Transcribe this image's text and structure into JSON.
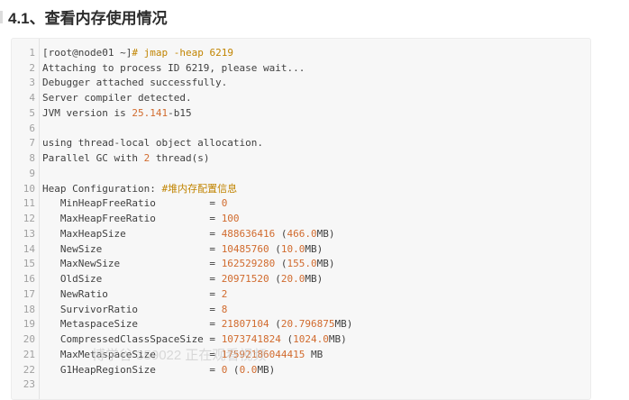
{
  "heading": "4.1、查看内存使用情况",
  "watermark": "博学谷 359022 正在观看视频",
  "lines": [
    {
      "n": "1",
      "segs": [
        {
          "t": "[root@node01 ~]",
          "c": "prompt"
        },
        {
          "t": "# jmap",
          "c": "cmd"
        },
        {
          "t": " -heap 6219",
          "c": "cmd"
        }
      ]
    },
    {
      "n": "2",
      "segs": [
        {
          "t": "Attaching to process ID 6219, please wait...",
          "c": ""
        }
      ]
    },
    {
      "n": "3",
      "segs": [
        {
          "t": "Debugger attached successfully.",
          "c": ""
        }
      ]
    },
    {
      "n": "4",
      "segs": [
        {
          "t": "Server compiler detected.",
          "c": ""
        }
      ]
    },
    {
      "n": "5",
      "segs": [
        {
          "t": "JVM version is ",
          "c": ""
        },
        {
          "t": "25.141",
          "c": "num"
        },
        {
          "t": "-b15",
          "c": ""
        }
      ]
    },
    {
      "n": "6",
      "segs": [
        {
          "t": "",
          "c": ""
        }
      ]
    },
    {
      "n": "7",
      "segs": [
        {
          "t": "using thread-local object allocation.",
          "c": ""
        }
      ]
    },
    {
      "n": "8",
      "segs": [
        {
          "t": "Parallel GC with ",
          "c": ""
        },
        {
          "t": "2",
          "c": "num"
        },
        {
          "t": " thread(s)",
          "c": ""
        }
      ]
    },
    {
      "n": "9",
      "segs": [
        {
          "t": "",
          "c": ""
        }
      ]
    },
    {
      "n": "10",
      "segs": [
        {
          "t": "Heap Configuration: ",
          "c": ""
        },
        {
          "t": "#堆内存配置信息",
          "c": "comment"
        }
      ]
    },
    {
      "n": "11",
      "segs": [
        {
          "t": "   MinHeapFreeRatio         = ",
          "c": ""
        },
        {
          "t": "0",
          "c": "num"
        }
      ]
    },
    {
      "n": "12",
      "segs": [
        {
          "t": "   MaxHeapFreeRatio         = ",
          "c": ""
        },
        {
          "t": "100",
          "c": "num"
        }
      ]
    },
    {
      "n": "13",
      "segs": [
        {
          "t": "   MaxHeapSize              = ",
          "c": ""
        },
        {
          "t": "488636416",
          "c": "num"
        },
        {
          "t": " (",
          "c": ""
        },
        {
          "t": "466.0",
          "c": "num"
        },
        {
          "t": "MB)",
          "c": ""
        }
      ]
    },
    {
      "n": "14",
      "segs": [
        {
          "t": "   NewSize                  = ",
          "c": ""
        },
        {
          "t": "10485760",
          "c": "num"
        },
        {
          "t": " (",
          "c": ""
        },
        {
          "t": "10.0",
          "c": "num"
        },
        {
          "t": "MB)",
          "c": ""
        }
      ]
    },
    {
      "n": "15",
      "segs": [
        {
          "t": "   MaxNewSize               = ",
          "c": ""
        },
        {
          "t": "162529280",
          "c": "num"
        },
        {
          "t": " (",
          "c": ""
        },
        {
          "t": "155.0",
          "c": "num"
        },
        {
          "t": "MB)",
          "c": ""
        }
      ]
    },
    {
      "n": "16",
      "segs": [
        {
          "t": "   OldSize                  = ",
          "c": ""
        },
        {
          "t": "20971520",
          "c": "num"
        },
        {
          "t": " (",
          "c": ""
        },
        {
          "t": "20.0",
          "c": "num"
        },
        {
          "t": "MB)",
          "c": ""
        }
      ]
    },
    {
      "n": "17",
      "segs": [
        {
          "t": "   NewRatio                 = ",
          "c": ""
        },
        {
          "t": "2",
          "c": "num"
        }
      ]
    },
    {
      "n": "18",
      "segs": [
        {
          "t": "   SurvivorRatio            = ",
          "c": ""
        },
        {
          "t": "8",
          "c": "num"
        }
      ]
    },
    {
      "n": "19",
      "segs": [
        {
          "t": "   MetaspaceSize            = ",
          "c": ""
        },
        {
          "t": "21807104",
          "c": "num"
        },
        {
          "t": " (",
          "c": ""
        },
        {
          "t": "20.796875",
          "c": "num"
        },
        {
          "t": "MB)",
          "c": ""
        }
      ]
    },
    {
      "n": "20",
      "segs": [
        {
          "t": "   CompressedClassSpaceSize = ",
          "c": ""
        },
        {
          "t": "1073741824",
          "c": "num"
        },
        {
          "t": " (",
          "c": ""
        },
        {
          "t": "1024.0",
          "c": "num"
        },
        {
          "t": "MB)",
          "c": ""
        }
      ]
    },
    {
      "n": "21",
      "segs": [
        {
          "t": "   MaxMetaspaceSize         = ",
          "c": ""
        },
        {
          "t": "17592186044415",
          "c": "num"
        },
        {
          "t": " MB",
          "c": ""
        }
      ]
    },
    {
      "n": "22",
      "segs": [
        {
          "t": "   G1HeapRegionSize         = ",
          "c": ""
        },
        {
          "t": "0",
          "c": "num"
        },
        {
          "t": " (",
          "c": ""
        },
        {
          "t": "0.0",
          "c": "num"
        },
        {
          "t": "MB)",
          "c": ""
        }
      ]
    },
    {
      "n": "23",
      "segs": [
        {
          "t": "",
          "c": ""
        }
      ]
    }
  ]
}
